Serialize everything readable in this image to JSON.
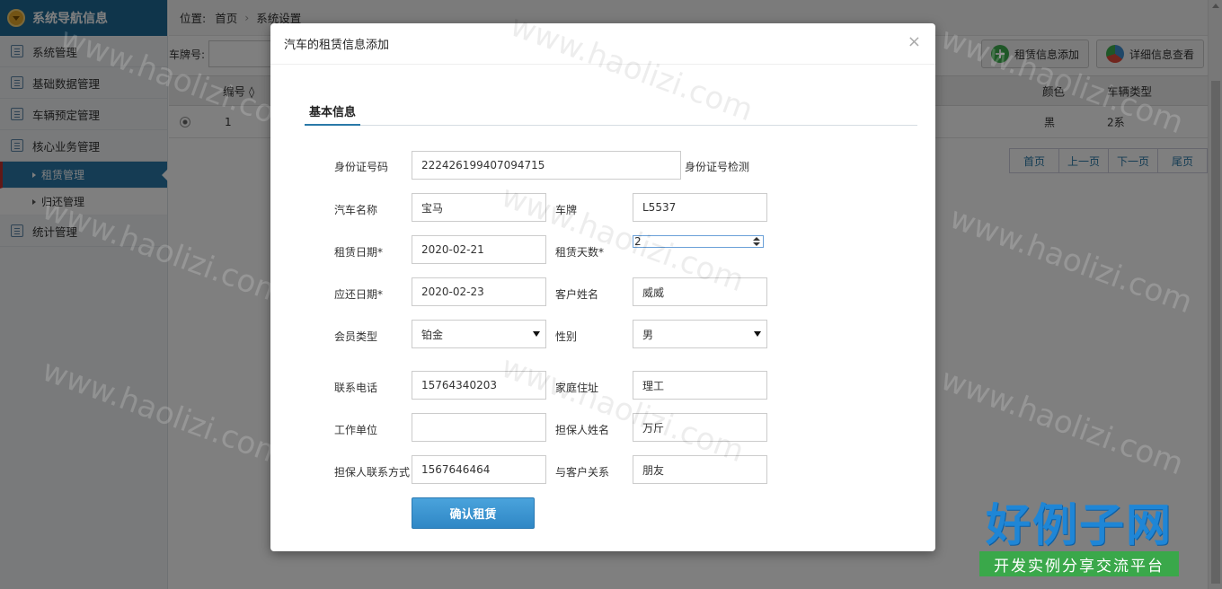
{
  "sidebar": {
    "title": "系统导航信息",
    "items": [
      {
        "label": "系统管理"
      },
      {
        "label": "基础数据管理"
      },
      {
        "label": "车辆预定管理"
      },
      {
        "label": "核心业务管理"
      }
    ],
    "subitems": [
      {
        "label": "租赁管理"
      },
      {
        "label": "归还管理"
      }
    ],
    "last_item": {
      "label": "统计管理"
    }
  },
  "breadcrumb": {
    "prefix": "位置:",
    "home": "首页",
    "sep": "›",
    "current": "系统设置"
  },
  "toolbar": {
    "plate_label": "车牌号:",
    "add_label": "租赁信息添加",
    "detail_label": "详细信息查看"
  },
  "grid": {
    "columns": {
      "id": "编号 ◊",
      "color": "颜色",
      "type": "车辆类型"
    },
    "rows": [
      {
        "id": "1",
        "color": "黑",
        "type": "2系"
      }
    ]
  },
  "pager": {
    "first": "首页",
    "prev": "上一页",
    "next": "下一页",
    "last": "尾页"
  },
  "modal": {
    "title": "汽车的租赁信息添加",
    "close": "×",
    "tab": "基本信息",
    "fields": {
      "id_card_label": "身份证号码",
      "id_card_value": "222426199407094715",
      "id_check_label": "身份证号检测",
      "car_name_label": "汽车名称",
      "car_name_value": "宝马",
      "plate_label": "车牌",
      "plate_value": "L5537",
      "rent_date_label": "租赁日期*",
      "rent_date_value": "2020-02-21",
      "rent_days_label": "租赁天数*",
      "rent_days_value": "2",
      "return_date_label": "应还日期*",
      "return_date_value": "2020-02-23",
      "customer_label": "客户姓名",
      "customer_value": "威威",
      "member_label": "会员类型",
      "member_value": "铂金",
      "gender_label": "性别",
      "gender_value": "男",
      "phone_label": "联系电话",
      "phone_value": "15764340203",
      "address_label": "家庭住址",
      "address_value": "理工",
      "work_label": "工作单位",
      "work_value": "",
      "guarantor_label": "担保人姓名",
      "guarantor_value": "万斤",
      "guarantor_contact_label": "担保人联系方式",
      "guarantor_contact_value": "1567646464",
      "relation_label": "与客户关系",
      "relation_value": "朋友"
    },
    "submit": "确认租赁"
  },
  "watermark": "www.haolizi.com",
  "brand": {
    "big": "好例子网",
    "small": "开发实例分享交流平台"
  },
  "colors": {
    "primary": "#2a79a8",
    "header": "#1f6a97",
    "active_marker": "#c2312f",
    "button": "#3a94d0"
  }
}
